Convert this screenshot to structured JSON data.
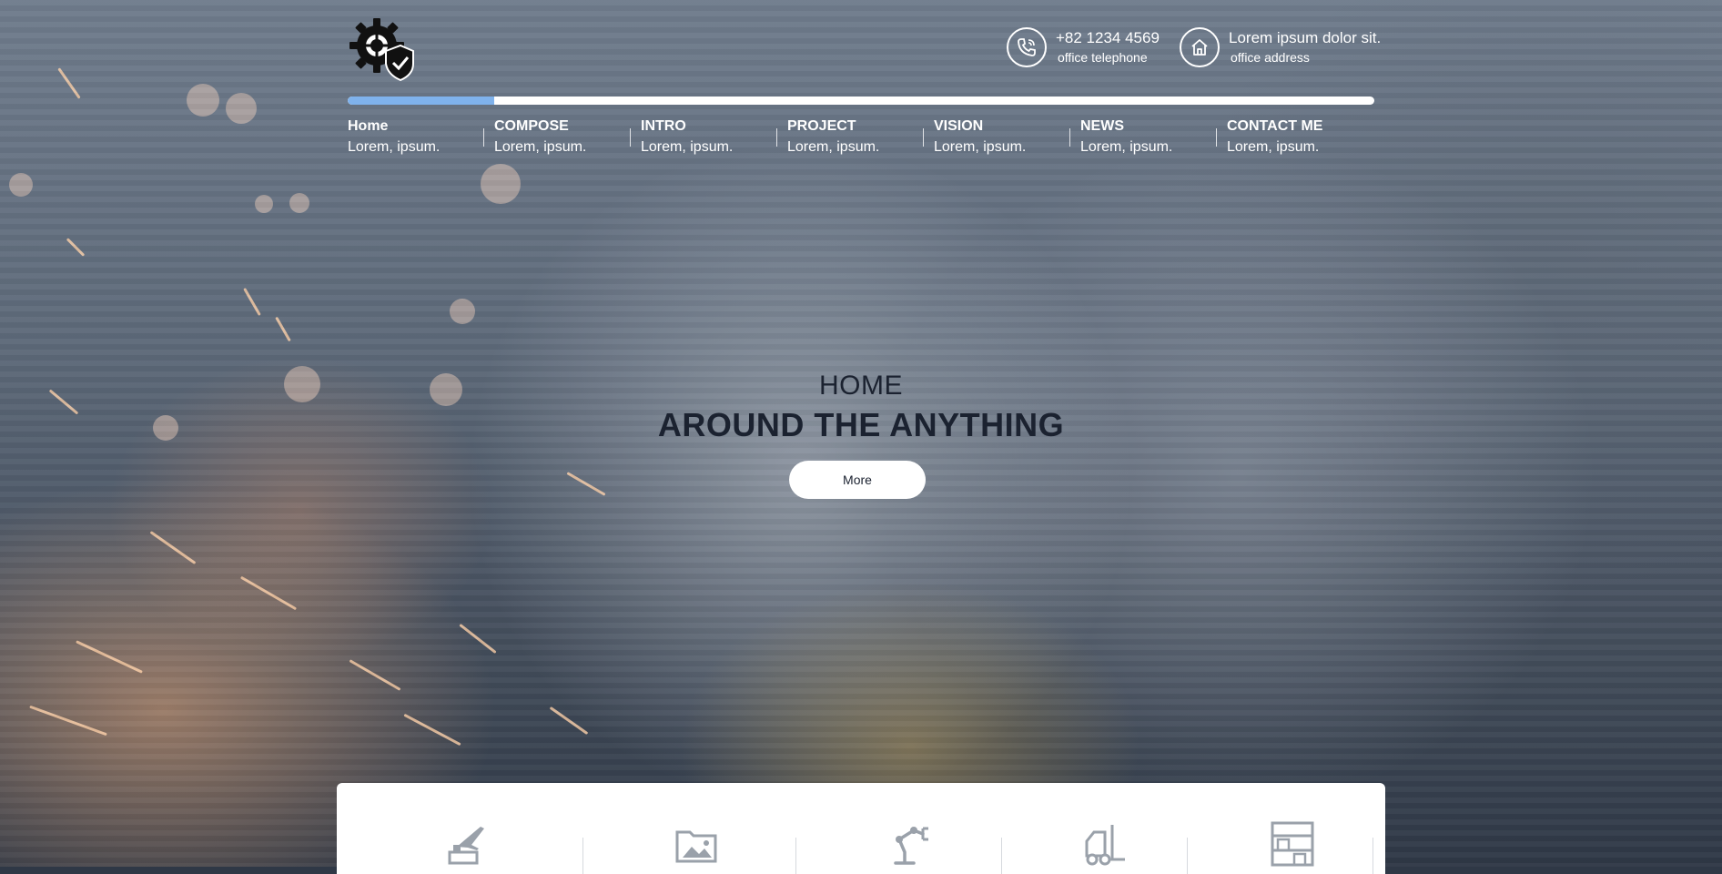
{
  "header": {
    "phone": {
      "number": "+82 1234 4569",
      "label": "office telephone",
      "icon": "phone-icon"
    },
    "address": {
      "text": "Lorem ipsum dolor sit.",
      "label": "office address",
      "icon": "home-icon"
    },
    "logo_icon": "gear-shield-logo"
  },
  "progress": {
    "fraction": 0.143,
    "fill_color": "#7fb2ec",
    "track_color": "#ffffff"
  },
  "nav": {
    "items": [
      {
        "title": "Home",
        "subtitle": "Lorem, ipsum."
      },
      {
        "title": "COMPOSE",
        "subtitle": "Lorem, ipsum."
      },
      {
        "title": "INTRO",
        "subtitle": "Lorem, ipsum."
      },
      {
        "title": "PROJECT",
        "subtitle": "Lorem, ipsum."
      },
      {
        "title": "VISION",
        "subtitle": "Lorem, ipsum."
      },
      {
        "title": "NEWS",
        "subtitle": "Lorem, ipsum."
      },
      {
        "title": "CONTACT ME",
        "subtitle": "Lorem, ipsum."
      }
    ]
  },
  "hero": {
    "kicker": "HOME",
    "title": "AROUND THE ANYTHING",
    "button": "More"
  },
  "features": {
    "icons": [
      "airplane-icon",
      "image-folder-icon",
      "robot-arm-icon",
      "forklift-icon",
      "warehouse-rack-icon"
    ]
  }
}
